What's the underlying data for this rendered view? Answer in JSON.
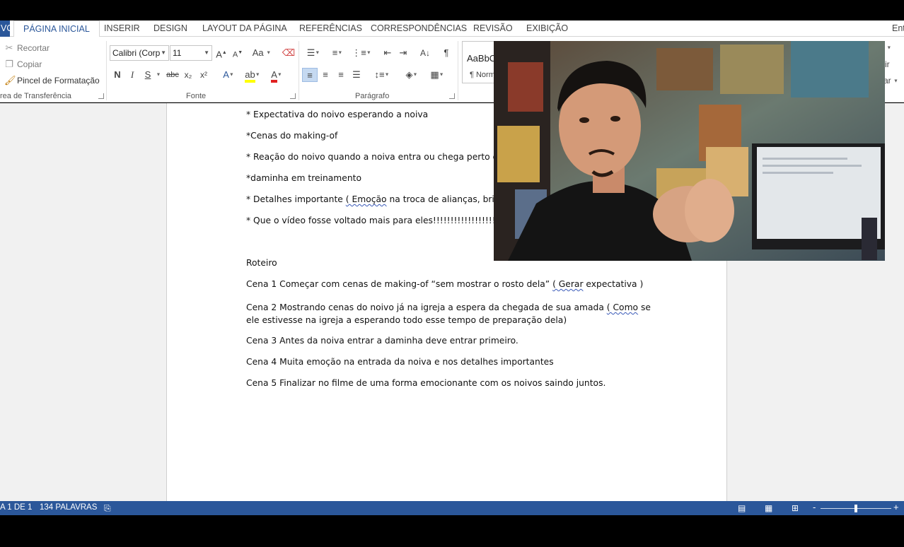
{
  "tabs": {
    "file": "VO",
    "items": [
      {
        "label": "PÁGINA INICIAL",
        "active": true
      },
      {
        "label": "INSERIR"
      },
      {
        "label": "DESIGN"
      },
      {
        "label": "LAYOUT DA PÁGINA"
      },
      {
        "label": "REFERÊNCIAS"
      },
      {
        "label": "CORRESPONDÊNCIAS"
      },
      {
        "label": "REVISÃO"
      },
      {
        "label": "EXIBIÇÃO"
      }
    ],
    "right_partial": "Ent"
  },
  "ribbon": {
    "clipboard": {
      "cut": "Recortar",
      "copy": "Copiar",
      "format_painter": "Pincel de Formatação",
      "group_label": "rea de Transferência"
    },
    "font": {
      "font_name": "Calibri (Corp",
      "font_size": "11",
      "case_label": "Aa",
      "bold": "N",
      "italic": "I",
      "underline": "S",
      "strike": "abc",
      "subscript": "x₂",
      "superscript": "x²",
      "text_effects": "A",
      "font_color": "A",
      "grow": "A",
      "shrink": "A",
      "group_label": "Fonte",
      "highlight_color": "#ffff00",
      "font_color_value": "#e02020"
    },
    "paragraph": {
      "group_label": "Parágrafo",
      "pilcrow": "¶"
    },
    "styles": {
      "sample": "AaBbC",
      "normal": "¶ Norm"
    },
    "right_edge": {
      "r1": "r",
      "r2": "ir",
      "r3": "ar"
    }
  },
  "document": {
    "lines": [
      "* Expectativa do noivo esperando a noiva",
      "*Cenas do making-of",
      "* Reação do noivo quando a noiva entra ou chega perto de",
      "*daminha em treinamento",
      "* Detalhes importante ( Emoção na troca de alianças, brind",
      "* Que o vídeo fosse voltado mais para eles!!!!!!!!!!!!!!!!!!!!!",
      "Roteiro",
      "Cena 1 Começar com cenas de making-of “sem mostrar o rosto dela” ( Gerar expectativa )",
      "Cena 2 Mostrando cenas do noivo já na igreja a espera da chegada de sua amada ( Como se ele estivesse na igreja a esperando todo esse tempo de preparação dela)",
      "Cena 3 Antes da noiva entrar a daminha deve entrar primeiro.",
      "Cena 4 Muita emoção na entrada da noiva e nos detalhes importantes",
      "Cena 5 Finalizar no filme de uma forma emocionante com os noivos saindo juntos."
    ]
  },
  "status": {
    "page": "A 1 DE 1",
    "words": "134 PALAVRAS",
    "zoom_minus": "-",
    "zoom_plus": "+"
  },
  "colors": {
    "accent": "#2b579a",
    "selected_button": "#c5d9f1"
  }
}
